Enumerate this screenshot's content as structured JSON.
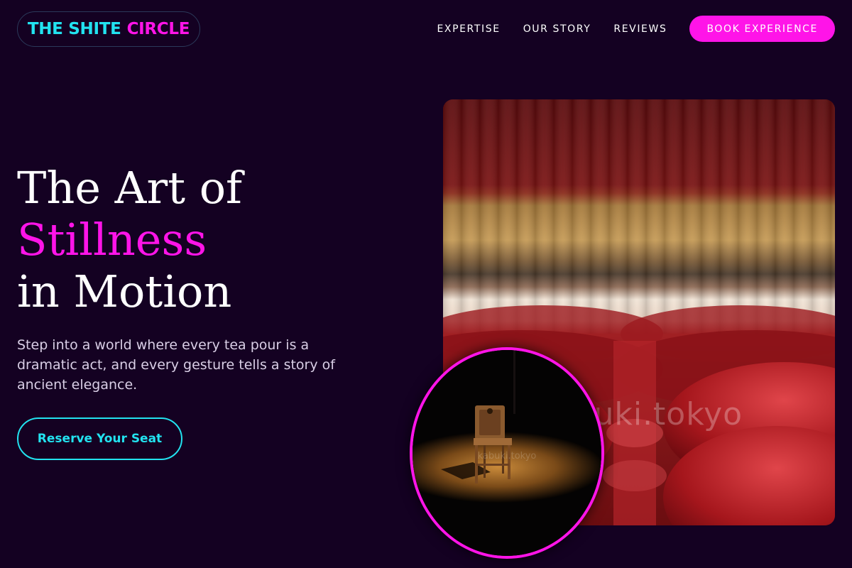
{
  "brand": {
    "part1": "THE SHITE",
    "part2": "CIRCLE"
  },
  "nav": {
    "links": [
      "EXPERTISE",
      "OUR STORY",
      "REVIEWS"
    ],
    "cta": "BOOK EXPERIENCE"
  },
  "hero": {
    "line1": "The Art of",
    "line2": "Stillness",
    "line3": "in Motion",
    "description": "Step into a world where every tea pour is a dramatic act, and every gesture tells a story of ancient elegance.",
    "cta": "Reserve Your Seat"
  },
  "images": {
    "main_watermark": "kabuki.tokyo",
    "inset_watermark": "kabuki.tokyo"
  },
  "colors": {
    "background": "#140122",
    "accent_magenta": "#ff14e8",
    "accent_cyan": "#22e3f0"
  }
}
